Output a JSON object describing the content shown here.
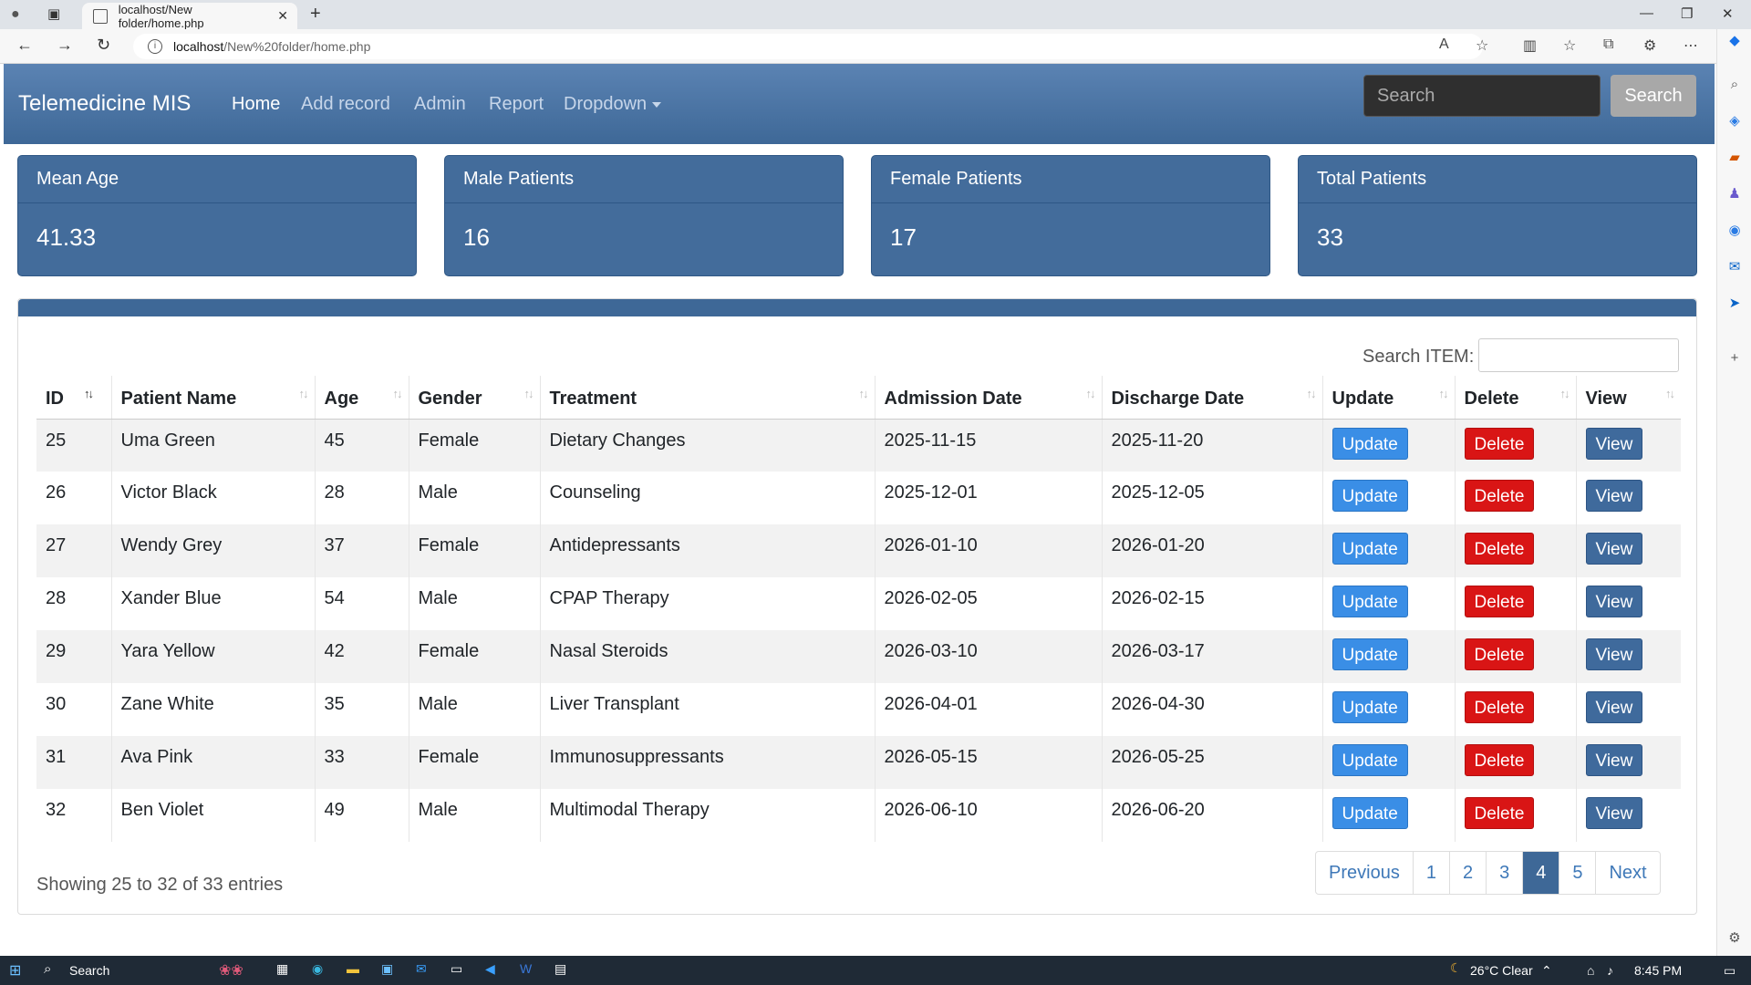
{
  "browser": {
    "tab_title": "localhost/New folder/home.php",
    "url_host": "localhost",
    "url_path": "/New%20folder/home.php"
  },
  "app": {
    "brand": "Telemedicine MIS",
    "nav": [
      "Home",
      "Add record",
      "Admin",
      "Report",
      "Dropdown"
    ],
    "search_placeholder": "Search",
    "search_button": "Search"
  },
  "stats": [
    {
      "label": "Mean Age",
      "value": "41.33"
    },
    {
      "label": "Male Patients",
      "value": "16"
    },
    {
      "label": "Female Patients",
      "value": "17"
    },
    {
      "label": "Total Patients",
      "value": "33"
    }
  ],
  "table": {
    "search_label": "Search ITEM:",
    "headers": [
      "ID",
      "Patient Name",
      "Age",
      "Gender",
      "Treatment",
      "Admission Date",
      "Discharge Date",
      "Update",
      "Delete",
      "View"
    ],
    "rows": [
      [
        "25",
        "Uma Green",
        "45",
        "Female",
        "Dietary Changes",
        "2025-11-15",
        "2025-11-20"
      ],
      [
        "26",
        "Victor Black",
        "28",
        "Male",
        "Counseling",
        "2025-12-01",
        "2025-12-05"
      ],
      [
        "27",
        "Wendy Grey",
        "37",
        "Female",
        "Antidepressants",
        "2026-01-10",
        "2026-01-20"
      ],
      [
        "28",
        "Xander Blue",
        "54",
        "Male",
        "CPAP Therapy",
        "2026-02-05",
        "2026-02-15"
      ],
      [
        "29",
        "Yara Yellow",
        "42",
        "Female",
        "Nasal Steroids",
        "2026-03-10",
        "2026-03-17"
      ],
      [
        "30",
        "Zane White",
        "35",
        "Male",
        "Liver Transplant",
        "2026-04-01",
        "2026-04-30"
      ],
      [
        "31",
        "Ava Pink",
        "33",
        "Female",
        "Immunosuppressants",
        "2026-05-15",
        "2026-05-25"
      ],
      [
        "32",
        "Ben Violet",
        "49",
        "Male",
        "Multimodal Therapy",
        "2026-06-10",
        "2026-06-20"
      ]
    ],
    "button_labels": {
      "update": "Update",
      "delete": "Delete",
      "view": "View"
    },
    "info": "Showing 25 to 32 of 33 entries",
    "pagination": [
      "Previous",
      "1",
      "2",
      "3",
      "4",
      "5",
      "Next"
    ],
    "current_page": "4"
  },
  "taskbar": {
    "search": "Search",
    "weather": "26°C  Clear",
    "time": "8:45 PM"
  }
}
